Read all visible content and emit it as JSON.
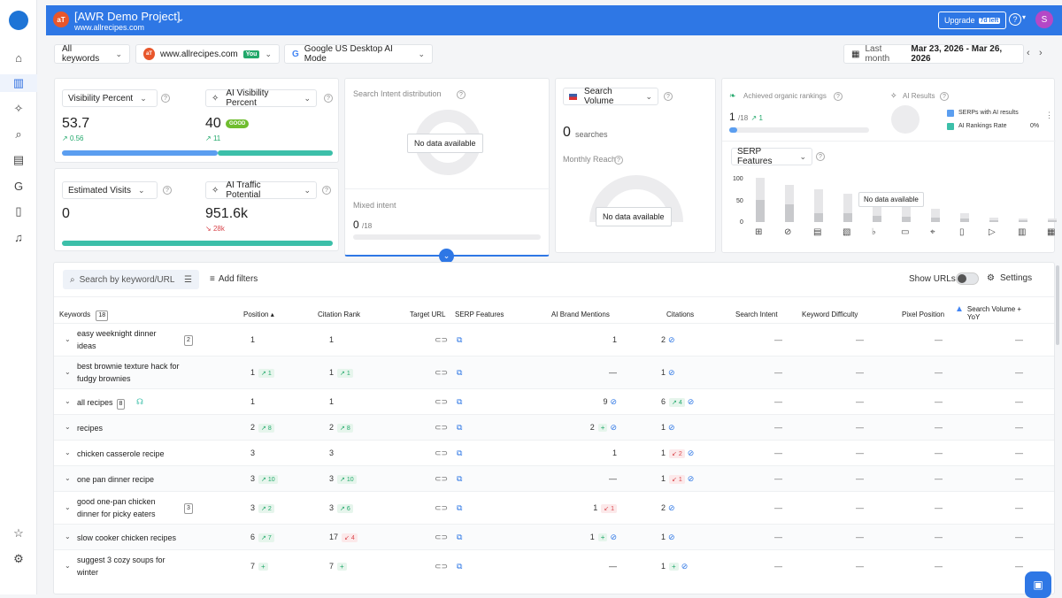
{
  "project": {
    "logo": "aT",
    "title": "[AWR Demo Project]",
    "subtitle": "www.allrecipes.com"
  },
  "topbar": {
    "upgrade": "Upgrade",
    "days_left": "7d left",
    "help": "?",
    "avatar": "S"
  },
  "filters": {
    "keywords": "All keywords",
    "site_logo": "aT",
    "site": "www.allrecipes.com",
    "you": "You",
    "engine": "Google US Desktop AI Mode",
    "date_label": "Last month",
    "date_range": "Mar 23, 2026 - Mar 26, 2026"
  },
  "vis": {
    "label": "Visibility Percent",
    "value": "53.7",
    "delta": "0.56",
    "ai_label": "AI Visibility Percent",
    "ai_value": "40",
    "ai_badge": "GOOD",
    "ai_delta": "11"
  },
  "visits": {
    "label": "Estimated Visits",
    "value": "0",
    "ai_label": "AI Traffic Potential",
    "ai_value": "951.6k",
    "ai_delta": "28k"
  },
  "intent": {
    "title": "Search Intent distribution",
    "nodata": "No data available",
    "mixed": "Mixed intent",
    "mixed_value": "0",
    "mixed_total": "/18"
  },
  "volume": {
    "label": "Search Volume",
    "value": "0",
    "unit": "searches",
    "reach": "Monthly Reach",
    "nodata": "No data available"
  },
  "organic": {
    "title": "Achieved organic rankings",
    "value": "1",
    "total": "/18",
    "delta": "1",
    "ai_title": "AI Results",
    "legend1": "SERPs with AI results",
    "legend2": "AI Rankings Rate",
    "legend2_val": "0%",
    "serp_btn": "SERP Features",
    "y100": "100",
    "y50": "50",
    "y0": "0",
    "nodata": "No data available"
  },
  "colors": {
    "accent": "#2e77e5",
    "good": "#22a86b",
    "bad": "#d9464c",
    "teal": "#3cbfa9"
  },
  "toolbar": {
    "search_placeholder": "Search by keyword/URL",
    "add_filters": "Add filters",
    "show_urls": "Show URLs",
    "settings": "Settings"
  },
  "table": {
    "headers": {
      "keywords": "Keywords",
      "kw_count": "18",
      "position": "Position",
      "citation_rank": "Citation Rank",
      "target_url": "Target URL",
      "serp": "SERP Features",
      "brand": "AI Brand Mentions",
      "citations": "Citations",
      "intent": "Search Intent",
      "difficulty": "Keyword Difficulty",
      "pixel": "Pixel Position",
      "volume": "Search Volume + YoY"
    },
    "rows": [
      {
        "kw1": "easy weeknight dinner",
        "kw2": "ideas",
        "cnt": "2",
        "pos": "1",
        "pos_d": "",
        "cit": "1",
        "cit_d": "",
        "brand": "1",
        "brand_t": "",
        "brand_d": "",
        "cits": "2",
        "cits_t": "",
        "cits_d": "",
        "dash": "—"
      },
      {
        "kw1": "best brownie texture hack for",
        "kw2": "fudgy brownies",
        "cnt": "",
        "pos": "1",
        "pos_d": "1",
        "cit": "1",
        "cit_d": "1",
        "brand": "—",
        "brand_t": "",
        "brand_d": "",
        "cits": "1",
        "cits_t": "",
        "cits_d": "",
        "dash": "—"
      },
      {
        "kw1": "all recipes",
        "kw2": "",
        "cnt": "8",
        "pos": "1",
        "pos_d": "",
        "cit": "1",
        "cit_d": "",
        "brand": "9",
        "brand_t": "",
        "brand_d": "",
        "cits": "6",
        "cits_t": "up",
        "cits_d": "4",
        "dash": "—"
      },
      {
        "kw1": "recipes",
        "kw2": "",
        "cnt": "",
        "pos": "2",
        "pos_d": "8",
        "cit": "2",
        "cit_d": "8",
        "brand": "2",
        "brand_t": "plus",
        "brand_d": "+",
        "cits": "1",
        "cits_t": "",
        "cits_d": "",
        "dash": "—"
      },
      {
        "kw1": "chicken casserole recipe",
        "kw2": "",
        "cnt": "",
        "pos": "3",
        "pos_d": "",
        "cit": "3",
        "cit_d": "",
        "brand": "1",
        "brand_t": "",
        "brand_d": "",
        "cits": "1",
        "cits_t": "dn",
        "cits_d": "2",
        "dash": "—"
      },
      {
        "kw1": "one pan dinner recipe",
        "kw2": "",
        "cnt": "",
        "pos": "3",
        "pos_d": "10",
        "cit": "3",
        "cit_d": "10",
        "brand": "—",
        "brand_t": "",
        "brand_d": "",
        "cits": "1",
        "cits_t": "dn",
        "cits_d": "1",
        "dash": "—"
      },
      {
        "kw1": "good one-pan chicken",
        "kw2": "dinner for picky eaters",
        "cnt": "3",
        "pos": "3",
        "pos_d": "2",
        "cit": "3",
        "cit_d": "6",
        "brand": "1",
        "brand_t": "dn",
        "brand_d": "1",
        "cits": "2",
        "cits_t": "",
        "cits_d": "",
        "dash": "—"
      },
      {
        "kw1": "slow cooker chicken recipes",
        "kw2": "",
        "cnt": "",
        "pos": "6",
        "pos_d": "7",
        "cit": "17",
        "cit_d": "4",
        "cit_dn": "1",
        "brand": "1",
        "brand_t": "plus",
        "brand_d": "+",
        "cits": "1",
        "cits_t": "",
        "cits_d": "",
        "dash": "—"
      },
      {
        "kw1": "suggest 3 cozy soups for",
        "kw2": "winter",
        "cnt": "",
        "pos": "7",
        "pos_d": "+",
        "cit": "7",
        "cit_d": "+",
        "brand": "—",
        "brand_t": "",
        "brand_d": "",
        "cits": "1",
        "cits_t": "plus",
        "cits_d": "+",
        "dash": "—"
      }
    ]
  }
}
